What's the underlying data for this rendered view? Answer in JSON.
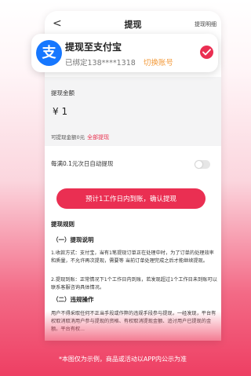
{
  "nav": {
    "back_glyph": "<",
    "title": "提现",
    "history_label": "提现明细"
  },
  "account_card": {
    "logo_glyph": "支",
    "title": "提现至支付宝",
    "bound_label": "已绑定138****1318",
    "switch_label": "切换账号",
    "selected": true,
    "icon": "alipay-icon"
  },
  "amount": {
    "label": "提现金额",
    "value": "¥ 1",
    "available_text": "可提现金额0元",
    "withdraw_all_label": "全部提现"
  },
  "auto_withdraw": {
    "label": "每满0.1元次日自动提现",
    "enabled": false
  },
  "confirm_button": {
    "label": "预计1工作日内到账，确认提现"
  },
  "rules": {
    "title": "提现规则",
    "section1_title": "（一）提现说明",
    "item1": "1.收款方式：支付宝，当有1笔提现订单正在处理中时，为了订单的处理效率和质量，不允许再次提现，需要等 当前订单处理完成之后才能继续提现。",
    "item2": "2.提现到账：正常情况下1个工作日内到账，若发现超过1个工作日未到账可以联系客服咨询具体情况。",
    "section2_title": "（二）违规操作",
    "item3": "用户不得采取任何不正当手段或作弊的违规手段参与提现，一经发现，平台有权取消取消用户参与提现的资格、有权取消提现金额、追讨用户已提现的金额。平台有权..."
  },
  "footer": {
    "disclaimer": "*本图仅为示例，商品或活动以APP内公示为准"
  },
  "colors": {
    "accent": "#ea2f52",
    "alipay": "#1677ff",
    "switch": "#f39b3c"
  }
}
